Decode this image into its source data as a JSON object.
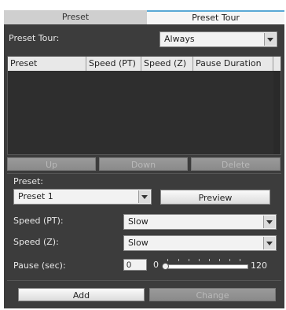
{
  "tabs": [
    {
      "label": "Preset"
    },
    {
      "label": "Preset Tour",
      "selected": true
    }
  ],
  "preset_tour": {
    "label": "Preset Tour:",
    "value": "Always"
  },
  "table": {
    "columns": [
      "Preset",
      "Speed (PT)",
      "Speed (Z)",
      "Pause Duration"
    ],
    "rows": []
  },
  "list_buttons": {
    "up": "Up",
    "down": "Down",
    "delete": "Delete"
  },
  "preset": {
    "label": "Preset:",
    "value": "Preset 1",
    "preview_label": "Preview"
  },
  "speed_pt": {
    "label": "Speed (PT):",
    "value": "Slow"
  },
  "speed_z": {
    "label": "Speed (Z):",
    "value": "Slow"
  },
  "pause": {
    "label": "Pause (sec):",
    "value": "0",
    "min_label": "0",
    "max_label": "120",
    "slider_level": 0
  },
  "actions": {
    "add": "Add",
    "change": "Change"
  },
  "colors": {
    "panel_bg": "#3c3c3c",
    "tab_accent": "#5aa9d6"
  }
}
